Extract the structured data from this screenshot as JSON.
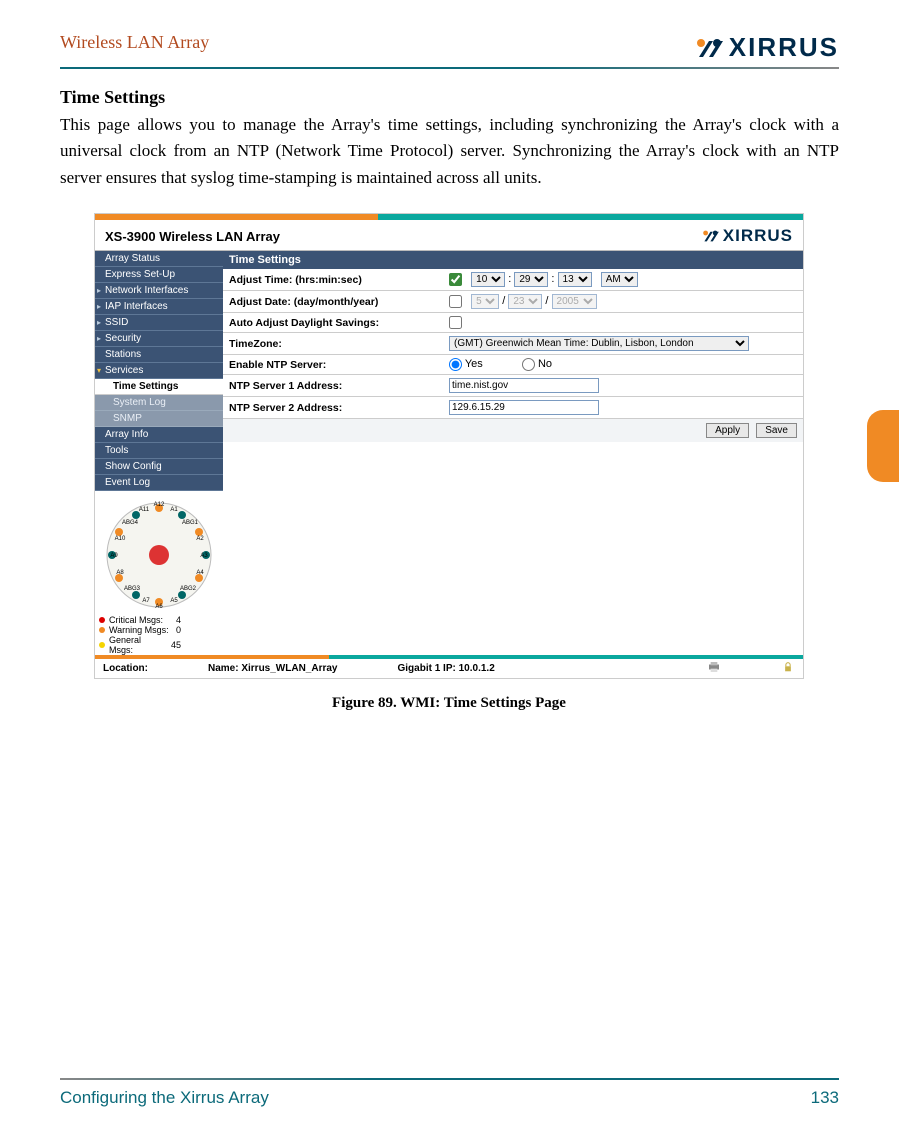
{
  "page": {
    "header_title": "Wireless LAN Array",
    "logo_text": "XIRRUS",
    "section_title": "Time Settings",
    "body_para": "This page allows you to manage the Array's time settings, including synchronizing the Array's clock with a universal clock from an NTP (Network Time Protocol) server. Synchronizing the Array's clock with an NTP server ensures that syslog time-stamping is maintained across all units.",
    "figure_caption": "Figure 89. WMI: Time Settings Page",
    "footer_left": "Configuring the Xirrus Array",
    "footer_right": "133"
  },
  "figure": {
    "title": "XS-3900 Wireless LAN Array",
    "logo_text": "XIRRUS",
    "sidebar": {
      "items": [
        {
          "label": "Array Status",
          "arrow": false
        },
        {
          "label": "Express Set-Up",
          "arrow": false
        },
        {
          "label": "Network Interfaces",
          "arrow": true
        },
        {
          "label": "IAP Interfaces",
          "arrow": true
        },
        {
          "label": "SSID",
          "arrow": true
        },
        {
          "label": "Security",
          "arrow": true
        },
        {
          "label": "Stations",
          "arrow": false
        },
        {
          "label": "Services",
          "arrow": true,
          "open": true
        }
      ],
      "sub_item_selected": "Time Settings",
      "sub_items": [
        "System Log",
        "SNMP"
      ],
      "items_after": [
        {
          "label": "Array Info"
        },
        {
          "label": "Tools"
        },
        {
          "label": "Show Config"
        },
        {
          "label": "Event Log"
        }
      ]
    },
    "main": {
      "header": "Time Settings",
      "rows": {
        "adjust_time_label": "Adjust Time: (hrs:min:sec)",
        "adjust_time_checked": true,
        "adjust_time_hrs": "10",
        "adjust_time_min": "29",
        "adjust_time_sec": "13",
        "adjust_time_ampm": "AM",
        "adjust_date_label": "Adjust Date: (day/month/year)",
        "adjust_date_checked": false,
        "adjust_date_day": "5",
        "adjust_date_month": "23",
        "adjust_date_year": "2005",
        "dst_label": "Auto Adjust Daylight Savings:",
        "dst_checked": false,
        "tz_label": "TimeZone:",
        "tz_value": "(GMT) Greenwich Mean Time: Dublin, Lisbon, London",
        "ntp_enable_label": "Enable NTP Server:",
        "ntp_yes": "Yes",
        "ntp_no": "No",
        "ntp_selected": "yes",
        "ntp1_label": "NTP Server 1 Address:",
        "ntp1_value": "time.nist.gov",
        "ntp2_label": "NTP Server 2 Address:",
        "ntp2_value": "129.6.15.29"
      },
      "buttons": {
        "apply": "Apply",
        "save": "Save"
      }
    },
    "array_labels": [
      "A12",
      "A11",
      "A1",
      "ABG4",
      "ABG1",
      "A10",
      "A2",
      "A9",
      "A3",
      "A8",
      "A4",
      "ABG3",
      "ABG2",
      "A7",
      "A6",
      "A5"
    ],
    "msgs": {
      "critical_label": "Critical Msgs:",
      "critical_val": "4",
      "warning_label": "Warning Msgs:",
      "warning_val": "0",
      "general_label": "General Msgs:",
      "general_val": "45"
    },
    "footer": {
      "location_label": "Location:",
      "name_label": "Name: Xirrus_WLAN_Array",
      "gig_label": "Gigabit 1 IP: 10.0.1.2"
    }
  }
}
